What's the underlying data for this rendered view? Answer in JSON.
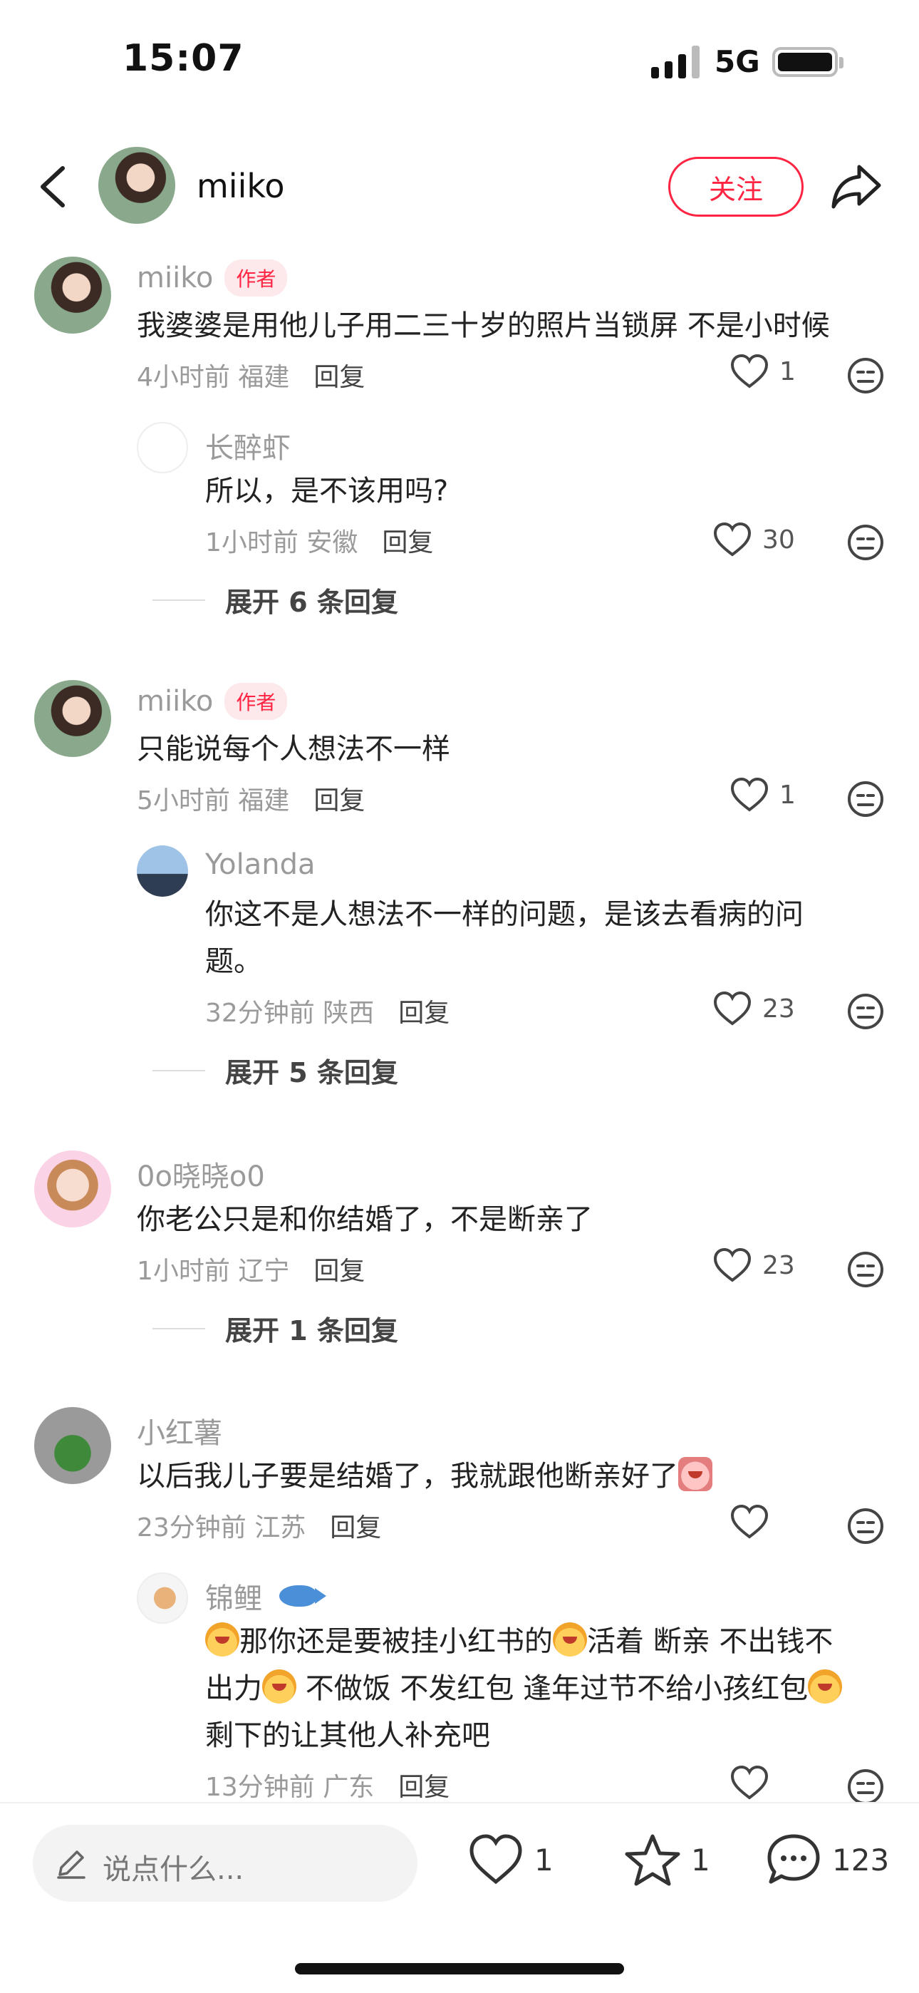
{
  "status": {
    "time": "15:07",
    "network": "5G"
  },
  "header": {
    "name": "miiko",
    "follow_label": "关注"
  },
  "comments": [
    {
      "name": "miiko",
      "badge": "作者",
      "text": "我婆婆是用他儿子用二三十岁的照片当锁屏 不是小时候",
      "time": "4小时前",
      "location": "福建",
      "reply": "回复",
      "likes": "1",
      "sub": {
        "name": "长醉虾",
        "text": "所以，是不该用吗?",
        "time": "1小时前",
        "location": "安徽",
        "reply": "回复",
        "likes": "30"
      },
      "expand": "展开 6 条回复"
    },
    {
      "name": "miiko",
      "badge": "作者",
      "text": "只能说每个人想法不一样",
      "time": "5小时前",
      "location": "福建",
      "reply": "回复",
      "likes": "1",
      "sub": {
        "name": "Yolanda",
        "text_line1": "你这不是人想法不一样的问题，是该去看病的问",
        "text_line2": "题。",
        "time": "32分钟前",
        "location": "陕西",
        "reply": "回复",
        "likes": "23"
      },
      "expand": "展开 5 条回复"
    },
    {
      "name": "0o晓晓o0",
      "text": "你老公只是和你结婚了，不是断亲了",
      "time": "1小时前",
      "location": "辽宁",
      "reply": "回复",
      "likes": "23",
      "expand": "展开 1 条回复"
    },
    {
      "name": "小红薯",
      "text": "以后我儿子要是结婚了，我就跟他断亲好了",
      "time": "23分钟前",
      "location": "江苏",
      "reply": "回复",
      "likes": "",
      "sub": {
        "name": "锦鲤",
        "seg1": "那你还是要被挂小红书的",
        "seg2": "活着 断亲 不出钱不",
        "seg3": "出力",
        "seg4": " 不做饭 不发红包 逢年过节不给小孩红包",
        "seg5": "剩下的让其他人补充吧",
        "time": "13分钟前",
        "location": "广东",
        "reply": "回复"
      }
    }
  ],
  "bottom": {
    "placeholder": "说点什么...",
    "likes": "1",
    "favorites": "1",
    "comments": "123"
  },
  "icons": [
    "back-icon",
    "share-icon",
    "heart-icon",
    "dislike-icon",
    "pen-icon",
    "star-icon",
    "comment-bubble-icon"
  ],
  "colors": {
    "accent": "#ff2442"
  }
}
